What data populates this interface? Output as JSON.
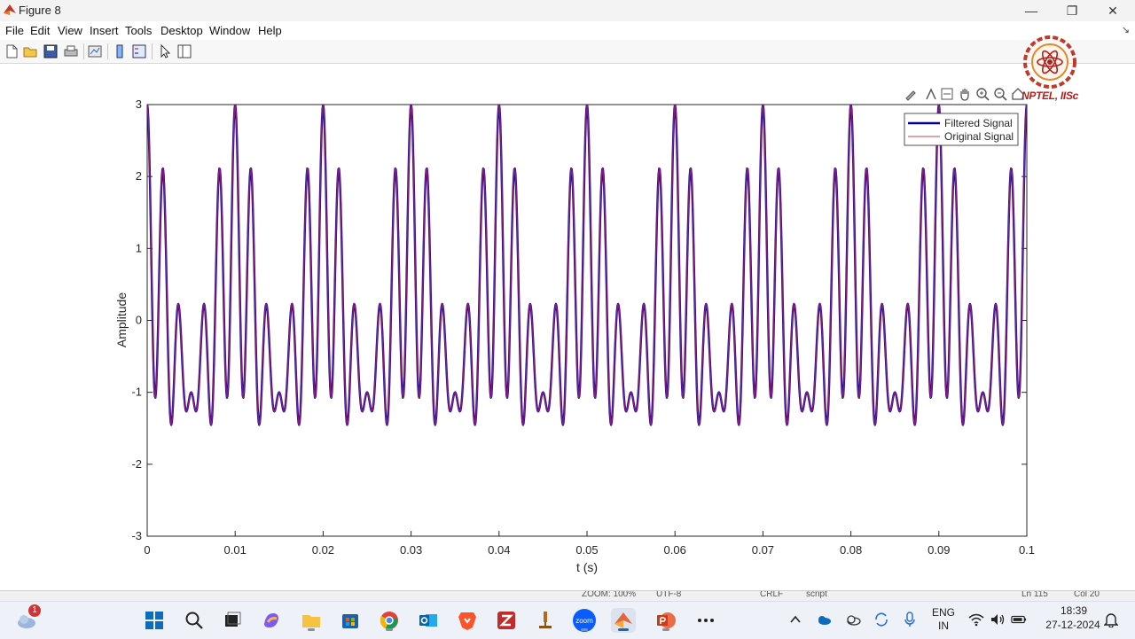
{
  "window": {
    "title": "Figure 8",
    "minimize": "—",
    "restore": "❐",
    "close": "✕"
  },
  "menu": {
    "items": [
      "File",
      "Edit",
      "View",
      "Insert",
      "Tools",
      "Desktop",
      "Window",
      "Help"
    ],
    "arrow": "↘"
  },
  "watermark": {
    "text": "NPTEL, IISc"
  },
  "chart_data": {
    "type": "line",
    "xlabel": "t (s)",
    "ylabel": "Amplitude",
    "xlim": [
      0,
      0.1
    ],
    "ylim": [
      -3,
      3
    ],
    "xticks": [
      0,
      0.01,
      0.02,
      0.03,
      0.04,
      0.05,
      0.06,
      0.07,
      0.08,
      0.09,
      0.1
    ],
    "xtick_labels": [
      "0",
      "0.01",
      "0.02",
      "0.03",
      "0.04",
      "0.05",
      "0.06",
      "0.07",
      "0.08",
      "0.09",
      "0.1"
    ],
    "yticks": [
      -3,
      -2,
      -1,
      0,
      1,
      2,
      3
    ],
    "ytick_labels": [
      "-3",
      "-2",
      "-1",
      "0",
      "1",
      "2",
      "3"
    ],
    "grid": false,
    "legend_position": "top-right",
    "signal": {
      "components": [
        {
          "amplitude": 1,
          "frequency_hz": 100,
          "phase": 1.5708
        },
        {
          "amplitude": 1,
          "frequency_hz": 500,
          "phase": 1.5708
        },
        {
          "amplitude": 1,
          "frequency_hz": 600,
          "phase": 1.5708
        }
      ],
      "samples": 1500
    },
    "series": [
      {
        "name": "Filtered Signal",
        "color": "#00008b",
        "line_width": 2.4,
        "peak_scale": 1.0
      },
      {
        "name": "Original Signal",
        "color": "#d2696e",
        "line_width": 1.2,
        "peak_scale": 1.0
      }
    ],
    "overlap_color": "#7d1d84"
  },
  "statusbar": {
    "segments": [
      "ZOOM: 100%",
      "UTF-8",
      "CRLF",
      "script",
      "Ln 115",
      "Col 20"
    ]
  },
  "taskbar": {
    "weather_badge": "1",
    "apps": [
      "start",
      "search",
      "task-view",
      "copilot",
      "file-explorer",
      "store",
      "chrome",
      "outlook",
      "brave",
      "zotero",
      "matlab-launcher",
      "zoom",
      "matlab",
      "powerpoint",
      "more"
    ],
    "zoom_label": "zoom",
    "lang_top": "ENG",
    "lang_bottom": "IN",
    "time": "18:39",
    "date": "27-12-2024"
  }
}
